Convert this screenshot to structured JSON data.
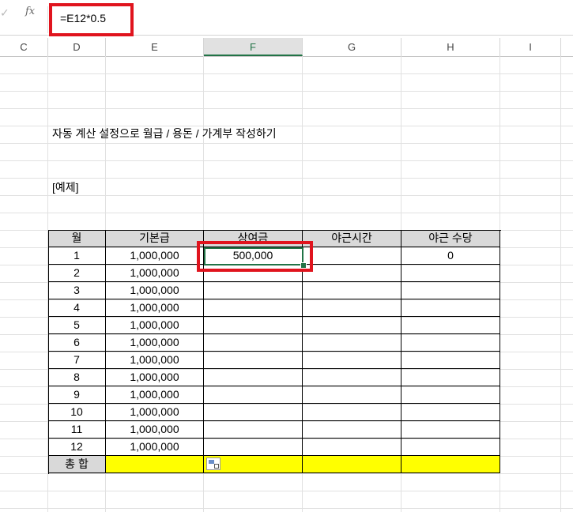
{
  "formula_bar": {
    "check_glyph": "✓",
    "fx_label": "fx",
    "formula": "=E12*0.5"
  },
  "columns": [
    "C",
    "D",
    "E",
    "F",
    "G",
    "H",
    "I"
  ],
  "active_column": "F",
  "sheet": {
    "title": "자동 계산 설정으로 월급 / 용돈 / 가계부 작성하기",
    "subtitle": "[예제]",
    "table": {
      "headers": [
        "월",
        "기본급",
        "상여금",
        "야근시간",
        "야근 수당"
      ],
      "rows": [
        [
          "1",
          "1,000,000",
          "500,000",
          "",
          "0"
        ],
        [
          "2",
          "1,000,000",
          "",
          "",
          ""
        ],
        [
          "3",
          "1,000,000",
          "",
          "",
          ""
        ],
        [
          "4",
          "1,000,000",
          "",
          "",
          ""
        ],
        [
          "5",
          "1,000,000",
          "",
          "",
          ""
        ],
        [
          "6",
          "1,000,000",
          "",
          "",
          ""
        ],
        [
          "7",
          "1,000,000",
          "",
          "",
          ""
        ],
        [
          "8",
          "1,000,000",
          "",
          "",
          ""
        ],
        [
          "9",
          "1,000,000",
          "",
          "",
          ""
        ],
        [
          "10",
          "1,000,000",
          "",
          "",
          ""
        ],
        [
          "11",
          "1,000,000",
          "",
          "",
          ""
        ],
        [
          "12",
          "1,000,000",
          "",
          "",
          ""
        ]
      ],
      "total_label": "총 합"
    }
  },
  "colors": {
    "header_fill": "#d9d9d9",
    "total_fill": "#ffff00",
    "highlight_border": "#e0141e",
    "selection": "#217346"
  }
}
